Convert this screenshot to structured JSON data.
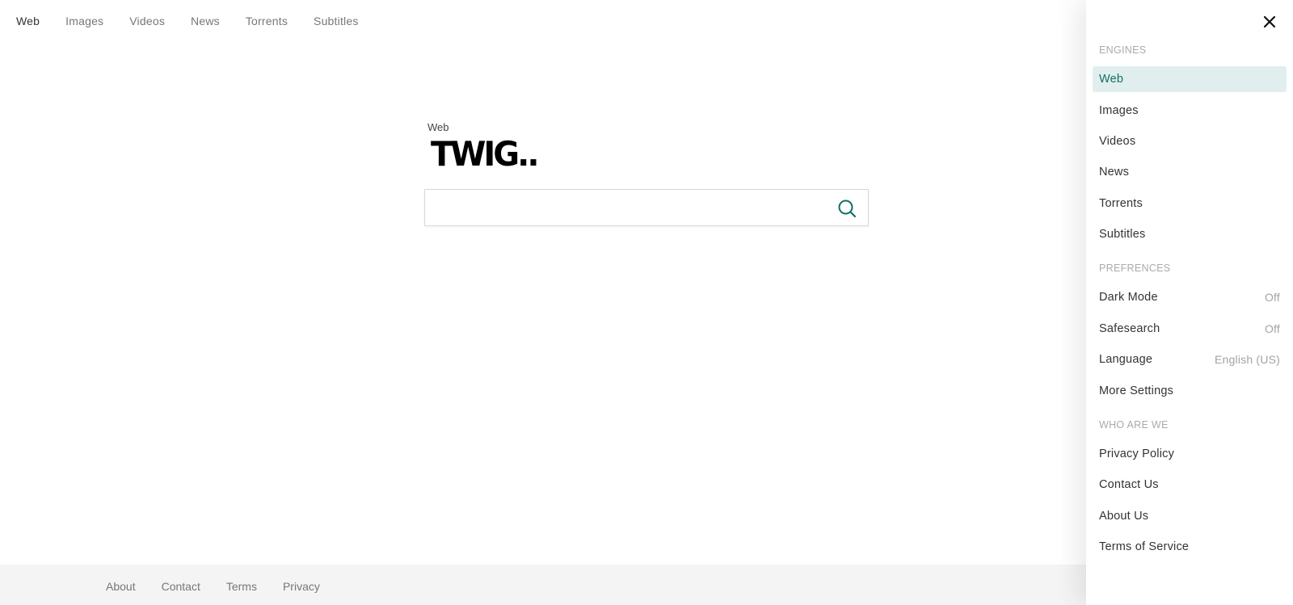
{
  "topnav": {
    "items": [
      "Web",
      "Images",
      "Videos",
      "News",
      "Torrents",
      "Subtitles"
    ],
    "active": "Web"
  },
  "hero": {
    "engine_label": "Web",
    "logo_text": "TWIG..",
    "search_value": "",
    "search_icon": "search-icon"
  },
  "footer": {
    "links": [
      "About",
      "Contact",
      "Terms",
      "Privacy"
    ]
  },
  "panel": {
    "close_icon": "close-icon",
    "engines_title": "ENGINES",
    "engines": [
      "Web",
      "Images",
      "Videos",
      "News",
      "Torrents",
      "Subtitles"
    ],
    "selected_engine": "Web",
    "preferences_title": "PREFRENCES",
    "preferences": [
      {
        "label": "Dark Mode",
        "value": "Off"
      },
      {
        "label": "Safesearch",
        "value": "Off"
      },
      {
        "label": "Language",
        "value": "English (US)"
      },
      {
        "label": "More Settings",
        "value": ""
      }
    ],
    "who_title": "WHO ARE WE",
    "who": [
      "Privacy Policy",
      "Contact Us",
      "About Us",
      "Terms of Service"
    ]
  },
  "colors": {
    "accent": "#127063",
    "selected_bg": "#e1eeee",
    "footer_bg": "#f4f4f4"
  }
}
